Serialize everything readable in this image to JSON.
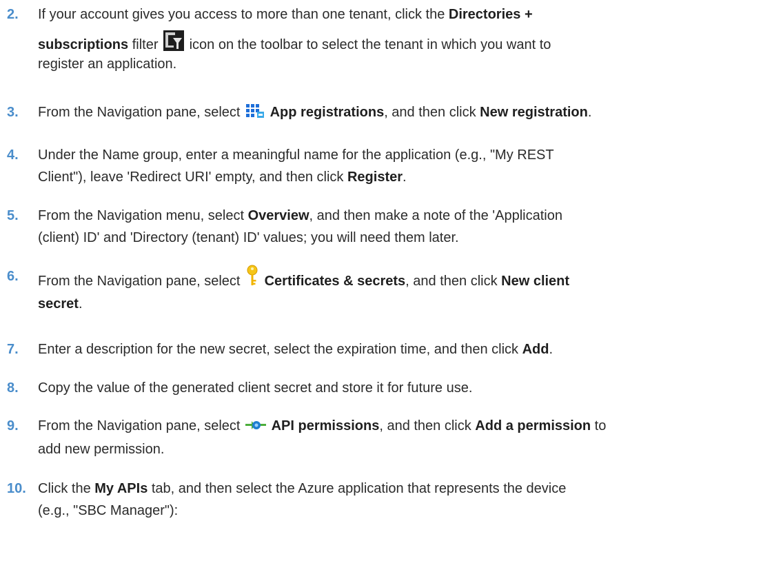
{
  "steps": [
    {
      "number": "2.",
      "parts": {
        "a": "If your account gives you access to more than one tenant, click the ",
        "b": "Directories +",
        "c": "subscriptions",
        "d": " filter ",
        "e": " icon on the toolbar to select the tenant in which you want to",
        "f": "register an application."
      },
      "icon": "directory-filter-icon"
    },
    {
      "number": "3.",
      "parts": {
        "a": "From the Navigation pane, select ",
        "b": "App registrations",
        "c": ", and then click ",
        "d": "New registration",
        "e": "."
      },
      "icon": "app-registrations-icon"
    },
    {
      "number": "4.",
      "parts": {
        "a": "Under the Name group, enter a meaningful name for the application (e.g., \"My REST",
        "b": "Client\"), leave 'Redirect URI' empty, and then click ",
        "c": "Register",
        "d": "."
      }
    },
    {
      "number": "5.",
      "parts": {
        "a": "From the Navigation menu, select ",
        "b": "Overview",
        "c": ", and then make a note of the 'Application",
        "d": "(client) ID' and 'Directory (tenant) ID' values; you will need them later."
      }
    },
    {
      "number": "6.",
      "parts": {
        "a": "From the Navigation pane, select ",
        "b": "Certificates & secrets",
        "c": ", and then click ",
        "d": "New client",
        "e": "secret",
        "f": "."
      },
      "icon": "key-icon"
    },
    {
      "number": "7.",
      "parts": {
        "a": "Enter a description for the new secret, select the expiration time, and then click ",
        "b": "Add",
        "c": "."
      }
    },
    {
      "number": "8.",
      "parts": {
        "a": "Copy the value of the generated client secret and store it for future use."
      }
    },
    {
      "number": "9.",
      "parts": {
        "a": "From the Navigation pane, select ",
        "b": "API permissions",
        "c": ", and then click ",
        "d": "Add a permission",
        "e": " to",
        "f": "add new permission."
      },
      "icon": "api-permissions-icon"
    },
    {
      "number": "10.",
      "parts": {
        "a": "Click the ",
        "b": "My APIs",
        "c": " tab, and then select the Azure application that represents the device",
        "d": "(e.g., \"SBC Manager\"):"
      }
    }
  ],
  "colors": {
    "step_number": "#4a8dcb",
    "text": "#2b2b2b"
  }
}
